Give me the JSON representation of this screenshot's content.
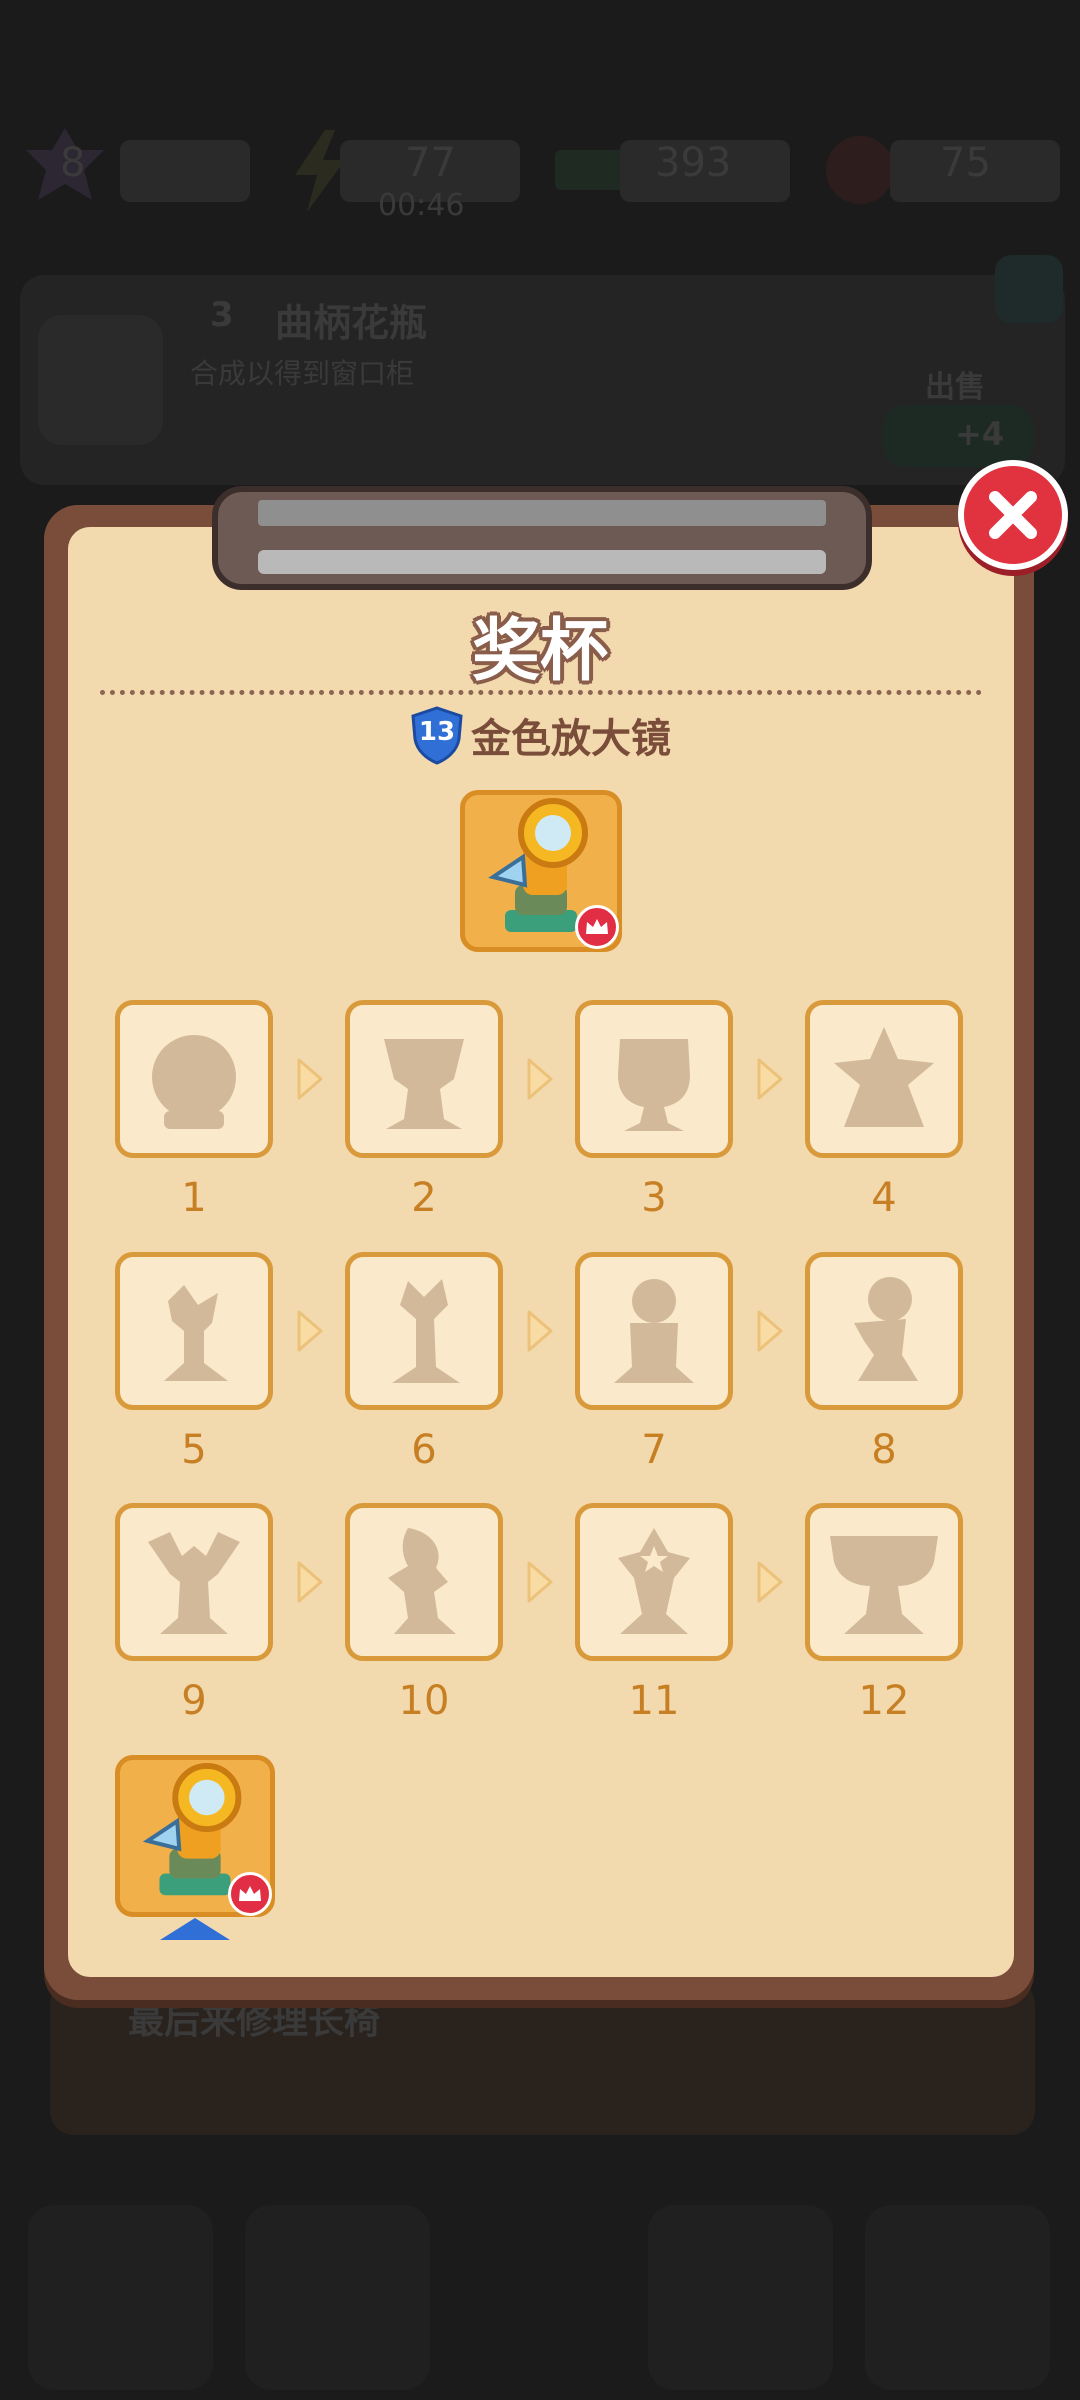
{
  "hud": {
    "level": "8",
    "energy": "77",
    "timer": "00:46",
    "cash": "393",
    "gems": "75"
  },
  "bg_task": {
    "level": "3",
    "name": "曲柄花瓶",
    "desc": "合成以得到窗口柜",
    "sell_label": "出售",
    "price": "+4"
  },
  "bg_quest": "最后来修理长椅",
  "modal": {
    "title": "奖杯",
    "item_level": "13",
    "item_name": "金色放大镜",
    "chain": [
      "1",
      "2",
      "3",
      "4",
      "5",
      "6",
      "7",
      "8",
      "9",
      "10",
      "11",
      "12"
    ]
  },
  "colors": {
    "panel": "#f3d9ae",
    "frame": "#7a4d3a",
    "tile_border": "#d99a3b",
    "number": "#c77f24",
    "close": "#e0323f"
  },
  "icons": {
    "close": "close-x-icon",
    "crown": "crown-icon",
    "level_badge": "shield-badge-icon"
  }
}
